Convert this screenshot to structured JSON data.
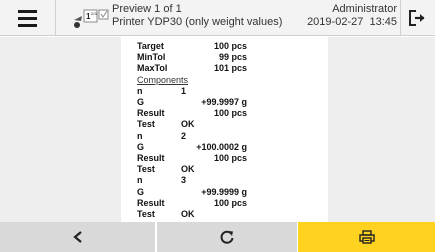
{
  "header": {
    "title": "Preview 1 of 1",
    "subtitle": "Printer YDP30 (only weight values)",
    "user": "Administrator",
    "date": "2019-02-27",
    "time": "13:45",
    "icon_badge": "1",
    "icon_superscript": "2/3"
  },
  "printout": {
    "summary": [
      {
        "label": "Target",
        "value": "100 pcs"
      },
      {
        "label": "MinTol",
        "value": "99 pcs"
      },
      {
        "label": "MaxTol",
        "value": "101 pcs"
      }
    ],
    "components_label": "Components",
    "components": [
      {
        "n_label": "n",
        "n": "1",
        "g_label": "G",
        "g": "+99.9997 g",
        "result_label": "Result",
        "result": "100 pcs",
        "test_label": "Test",
        "test": "OK"
      },
      {
        "n_label": "n",
        "n": "2",
        "g_label": "G",
        "g": "+100.0002 g",
        "result_label": "Result",
        "result": "100 pcs",
        "test_label": "Test",
        "test": "OK"
      },
      {
        "n_label": "n",
        "n": "3",
        "g_label": "G",
        "g": "+99.9999 g",
        "result_label": "Result",
        "result": "100 pcs",
        "test_label": "Test",
        "test": "OK"
      }
    ]
  },
  "footer": {
    "back_icon": "chevron-left-icon",
    "refresh_icon": "refresh-icon",
    "print_icon": "printer-icon"
  },
  "colors": {
    "accent": "#ffd21f",
    "footer_gray": "#d9d9d9",
    "background": "#eeeeee"
  }
}
